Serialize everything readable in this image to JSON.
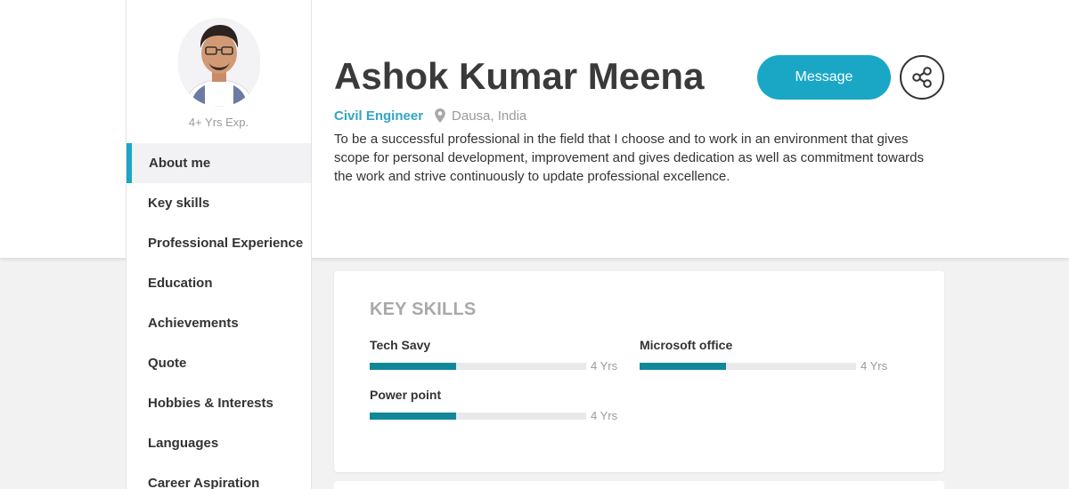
{
  "profile": {
    "name": "Ashok Kumar Meena",
    "experience": "4+ Yrs Exp.",
    "role": "Civil Engineer",
    "location": "Dausa, India",
    "about": "To be a successful professional in the field that I choose and to work in an environment that gives scope for personal development, improvement and gives dedication as well as commitment towards the work and strive continuously to update professional excellence."
  },
  "actions": {
    "message_label": "Message",
    "share_icon": "share-icon"
  },
  "sidebar": {
    "items": [
      {
        "label": "About me",
        "active": true
      },
      {
        "label": "Key skills"
      },
      {
        "label": "Professional Experience"
      },
      {
        "label": "Education"
      },
      {
        "label": "Achievements"
      },
      {
        "label": "Quote"
      },
      {
        "label": "Hobbies & Interests"
      },
      {
        "label": "Languages"
      },
      {
        "label": "Career Aspiration"
      }
    ]
  },
  "key_skills": {
    "title": "KEY SKILLS",
    "items": [
      {
        "name": "Tech Savy",
        "years": "4 Yrs",
        "level": 0.4
      },
      {
        "name": "Microsoft office",
        "years": "4 Yrs",
        "level": 0.4
      },
      {
        "name": "Power point",
        "years": "4 Yrs",
        "level": 0.4
      }
    ]
  },
  "colors": {
    "accent": "#1aa7c6",
    "bar": "#11889a",
    "role": "#31a5c4"
  }
}
